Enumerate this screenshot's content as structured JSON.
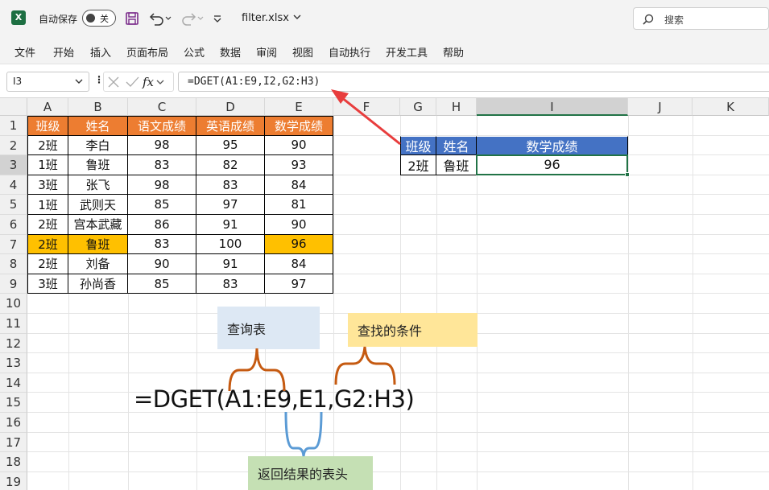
{
  "titlebar": {
    "app_icon": "excel-logo-icon",
    "app_icon_letter": "X",
    "autosave_label": "自动保存",
    "autosave_state": "关",
    "filename": "filter.xlsx",
    "search_placeholder": "搜索"
  },
  "ribbon": {
    "tabs": [
      "文件",
      "开始",
      "插入",
      "页面布局",
      "公式",
      "数据",
      "审阅",
      "视图",
      "自动执行",
      "开发工具",
      "帮助"
    ]
  },
  "formula_bar": {
    "name_box": "I3",
    "fx_label": "fx",
    "formula": "=DGET(A1:E9,I2,G2:H3)"
  },
  "grid": {
    "columns": [
      "A",
      "B",
      "C",
      "D",
      "E",
      "F",
      "G",
      "H",
      "I",
      "J",
      "K"
    ],
    "selected_column": "I",
    "rows": [
      "1",
      "2",
      "3",
      "4",
      "5",
      "6",
      "7",
      "8",
      "9",
      "10",
      "11",
      "12",
      "13",
      "14",
      "15",
      "16",
      "17",
      "18",
      "19"
    ],
    "selected_row": "3"
  },
  "data_table": {
    "headers": [
      "班级",
      "姓名",
      "语文成绩",
      "英语成绩",
      "数学成绩"
    ],
    "rows": [
      [
        "2班",
        "李白",
        "98",
        "95",
        "90"
      ],
      [
        "1班",
        "鲁班",
        "83",
        "82",
        "93"
      ],
      [
        "3班",
        "张飞",
        "98",
        "83",
        "84"
      ],
      [
        "1班",
        "武则天",
        "85",
        "97",
        "81"
      ],
      [
        "2班",
        "宫本武藏",
        "86",
        "91",
        "90"
      ],
      [
        "2班",
        "鲁班",
        "83",
        "100",
        "96"
      ],
      [
        "2班",
        "刘备",
        "90",
        "91",
        "84"
      ],
      [
        "3班",
        "孙尚香",
        "85",
        "83",
        "97"
      ]
    ],
    "highlight_color": "#ffc000",
    "header_color": "#ed7d31"
  },
  "criteria_table": {
    "headers": [
      "班级",
      "姓名",
      "数学成绩"
    ],
    "row": [
      "2班",
      "鲁班",
      "96"
    ],
    "header_color": "#4472c4"
  },
  "annotations": {
    "query_table": "查询表",
    "criteria": "查找的条件",
    "return_header": "返回结果的表头",
    "big_formula": "=DGET(A1:E9,E1,G2:H3)"
  }
}
